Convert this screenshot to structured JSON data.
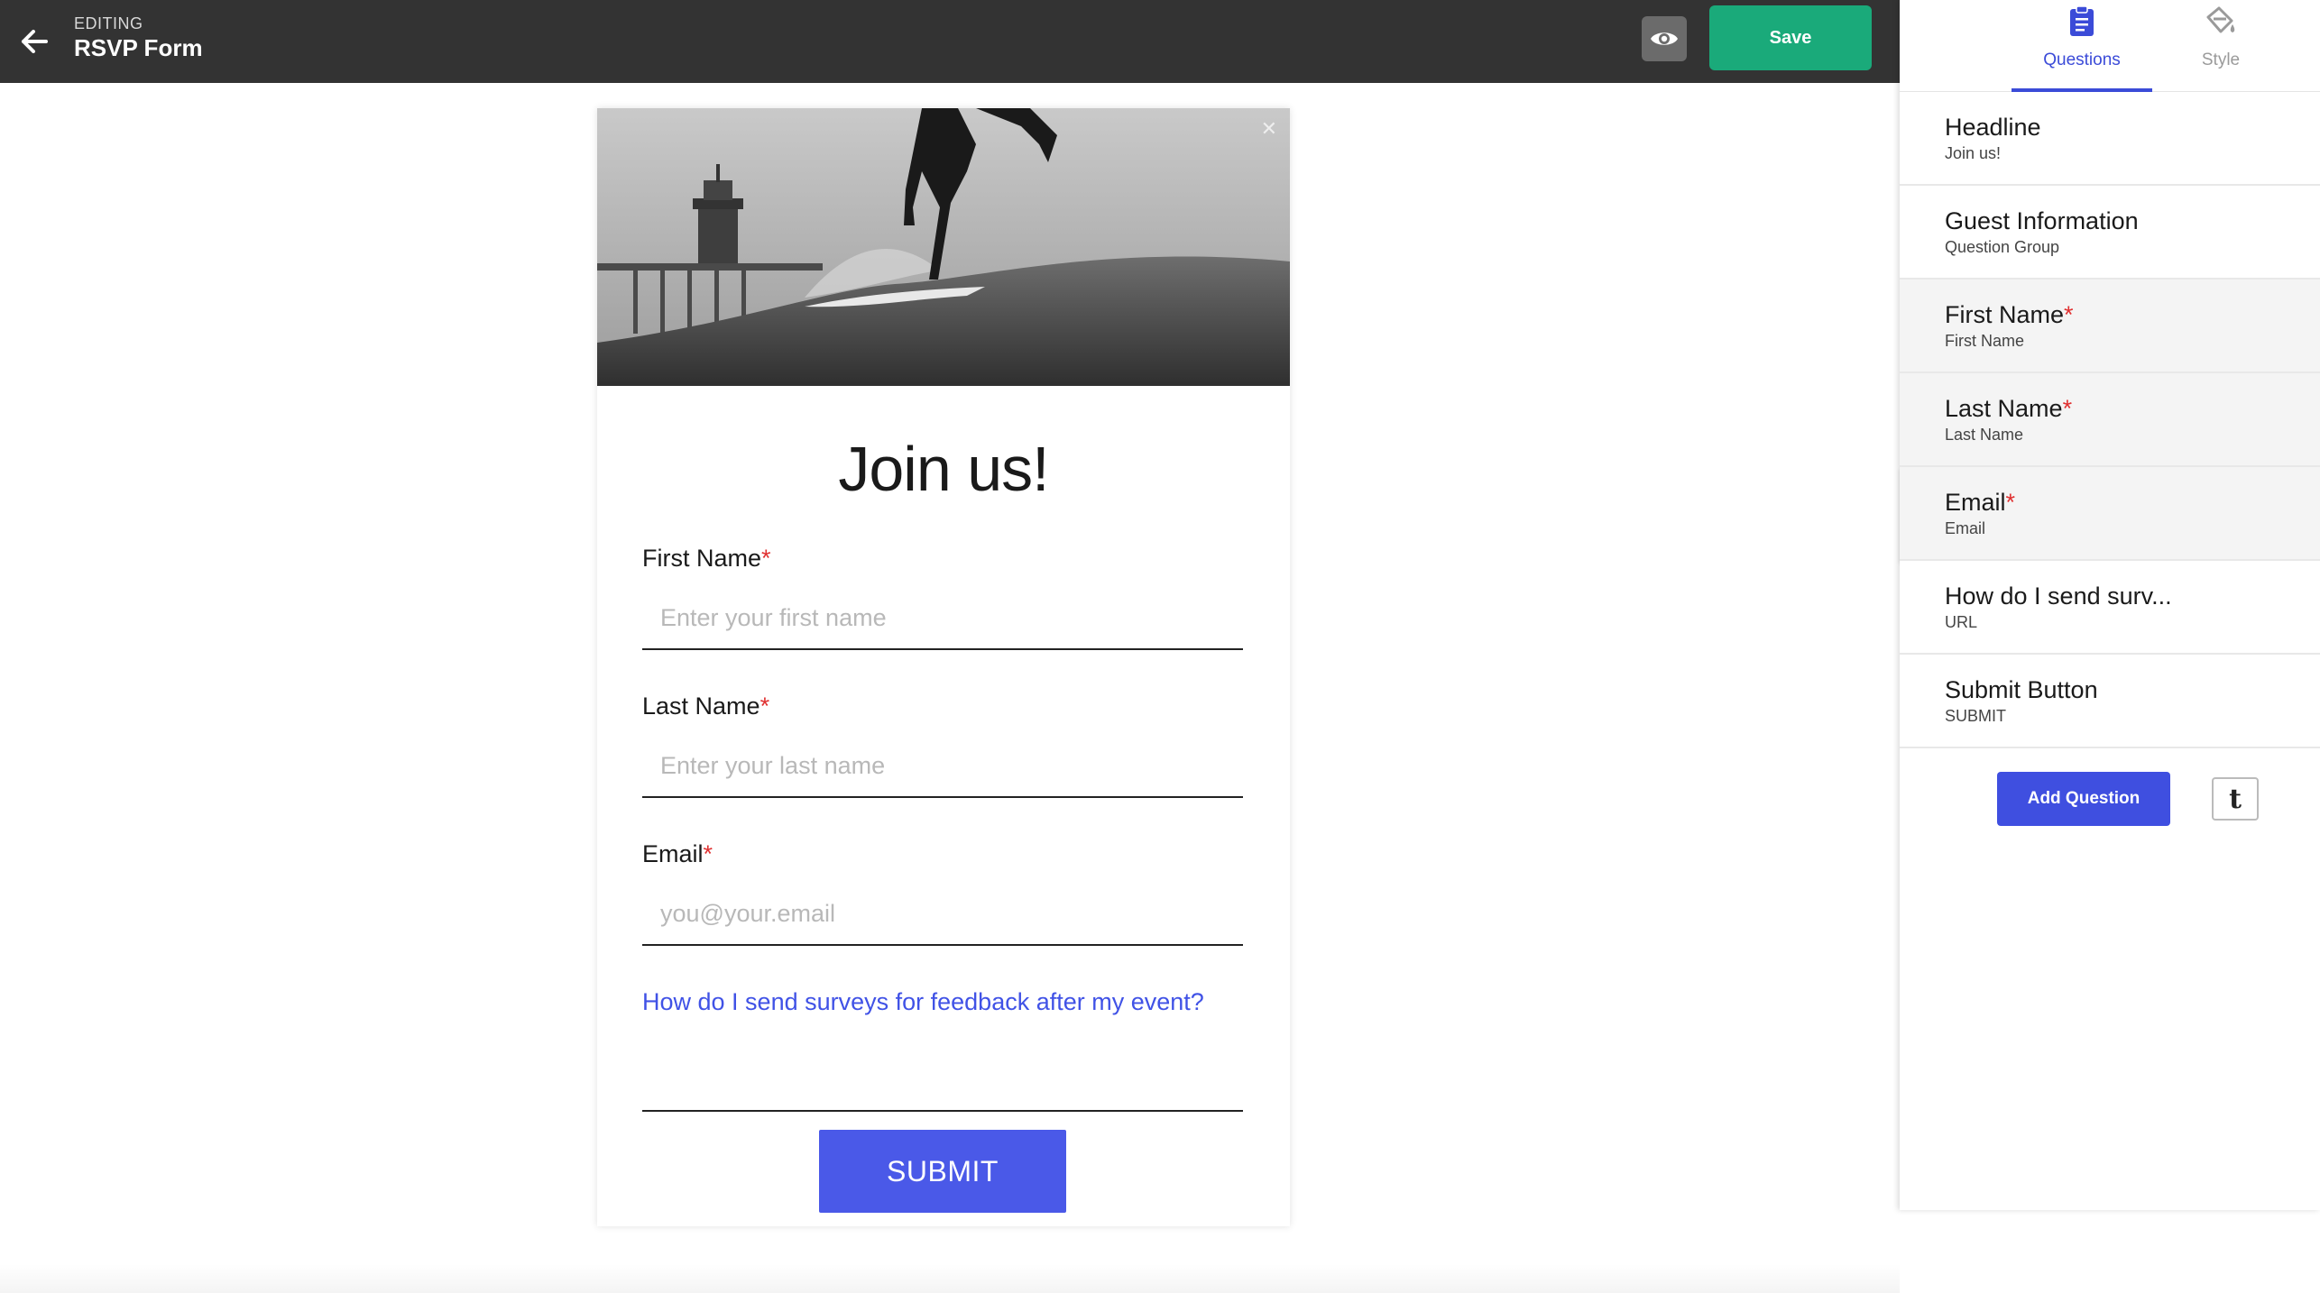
{
  "header": {
    "editing_label": "EDITING",
    "form_title": "RSVP Form",
    "save_label": "Save"
  },
  "form": {
    "headline": "Join us!",
    "first_name": {
      "label": "First Name",
      "required": "*",
      "placeholder": "Enter your first name"
    },
    "last_name": {
      "label": "Last Name",
      "required": "*",
      "placeholder": "Enter your last name"
    },
    "email": {
      "label": "Email",
      "required": "*",
      "placeholder": "you@your.email"
    },
    "url_question": {
      "label": "How do I send surveys for feedback after my event?"
    },
    "submit_label": "SUBMIT"
  },
  "panel": {
    "tabs": [
      {
        "label": "Questions",
        "icon": "clipboard-icon",
        "active": true
      },
      {
        "label": "Style",
        "icon": "paint-bucket-icon",
        "active": false
      }
    ],
    "questions": [
      {
        "title": "Headline",
        "required": "",
        "subtitle": "Join us!"
      },
      {
        "title": "Guest Information",
        "required": "",
        "subtitle": "Question Group"
      },
      {
        "title": "First Name",
        "required": "*",
        "subtitle": "First Name"
      },
      {
        "title": "Last Name",
        "required": "*",
        "subtitle": "Last Name"
      },
      {
        "title": "Email",
        "required": "*",
        "subtitle": "Email"
      },
      {
        "title": "How do I send surv...",
        "required": "",
        "subtitle": "URL"
      },
      {
        "title": "Submit Button",
        "required": "",
        "subtitle": "SUBMIT"
      }
    ],
    "add_question_label": "Add Question",
    "theme_glyph": "t"
  },
  "colors": {
    "topbar": "#333333",
    "save": "#1aaa7a",
    "accent": "#3b4bd8",
    "submit": "#4a59e8",
    "required": "#e03131",
    "link": "#4052e6"
  }
}
